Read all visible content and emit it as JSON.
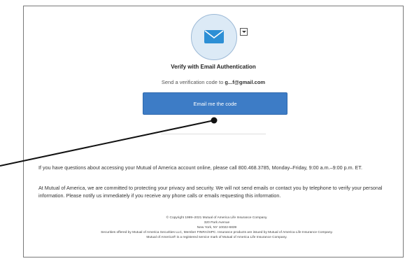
{
  "auth": {
    "icon": "envelope-icon",
    "icon_color": "#2d8fd5",
    "dropdown_icon": "caret-down-icon",
    "title": "Verify with Email Authentication",
    "subtitle_prefix": "Send a verification code to ",
    "masked_email": "g...f@gmail.com",
    "button_label": "Email me the code",
    "button_color": "#3d7cc6"
  },
  "info": {
    "questions_text": "If you have questions about accessing your Mutual of America account online, please call 800.468.3785, Monday–Friday, 9:00 a.m.–9:00 p.m. ET.",
    "privacy_text": "At Mutual of America, we are committed to protecting your privacy and security. We will not send emails or contact you by telephone to verify your personal information. Please notify us immediately if you receive any phone calls or emails requesting this information."
  },
  "footer": {
    "copyright": "© Copyright 1999–2021 Mutual of America Life Insurance Company.",
    "address_line1": "320 Park Avenue",
    "address_line2": "New York, NY 10022-6839",
    "securities": "Securities offered by Mutual of America Securities LLC, Member FINRA/SIPC. Insurance products are issued by Mutual of America Life Insurance Company.",
    "trademark": "Mutual of America® is a registered service mark of Mutual of America Life Insurance Company."
  }
}
